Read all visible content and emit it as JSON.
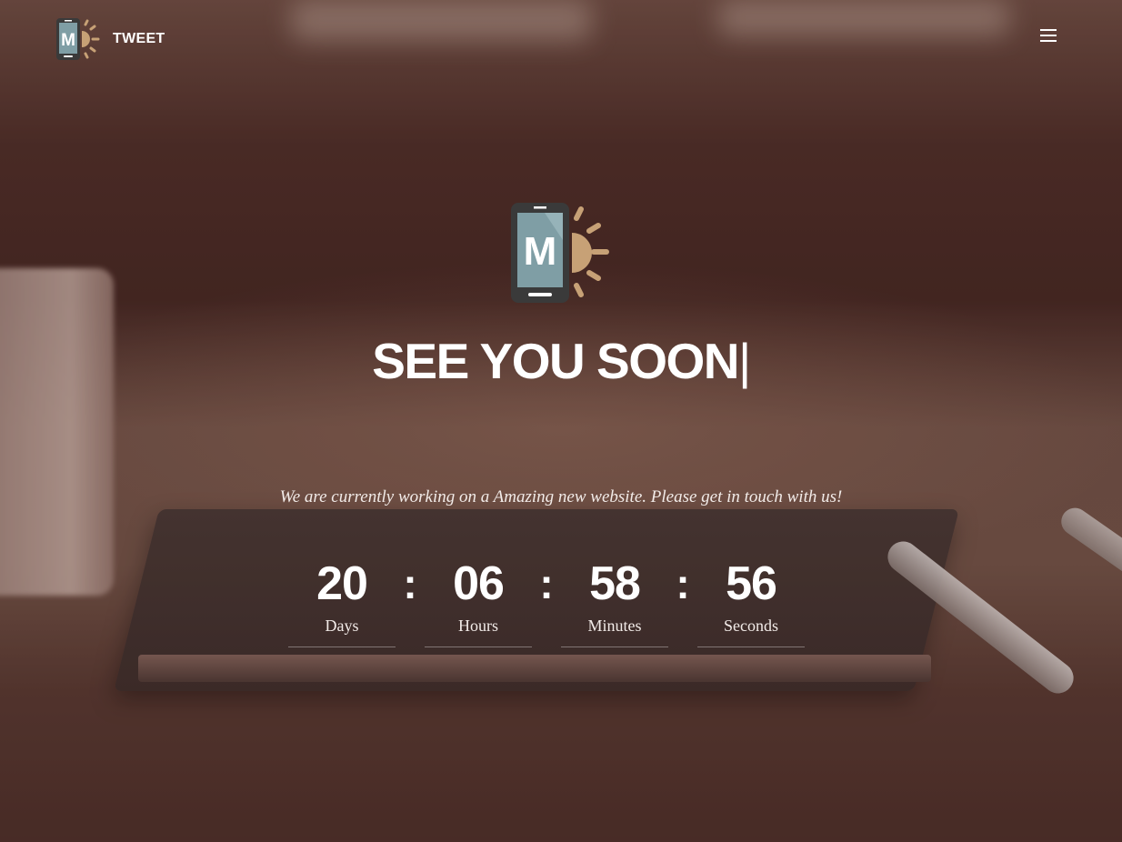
{
  "header": {
    "logo_letter": "M",
    "logo_text": "TWEET"
  },
  "hero": {
    "logo_letter": "M",
    "title": "SEE YOU SOON",
    "cursor": "|",
    "subtitle": "We are currently working on a Amazing new website. Please get in touch with us!"
  },
  "countdown": {
    "separator": ":",
    "units": [
      {
        "value": "20",
        "label": "Days"
      },
      {
        "value": "06",
        "label": "Hours"
      },
      {
        "value": "58",
        "label": "Minutes"
      },
      {
        "value": "56",
        "label": "Seconds"
      }
    ]
  },
  "icons": {
    "menu": "hamburger-menu-icon",
    "logo": "phone-sun-logo-icon"
  },
  "colors": {
    "logo_phone_body": "#3a3a3a",
    "logo_phone_screen": "#7f9ea5",
    "logo_sun": "#c7a176",
    "text": "#ffffff"
  }
}
